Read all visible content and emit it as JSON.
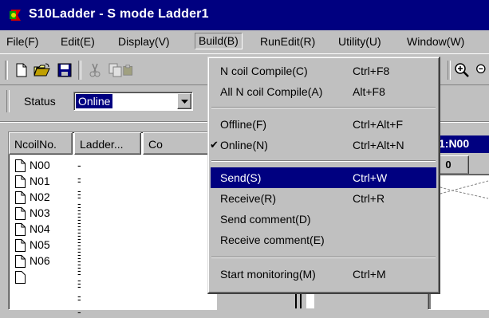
{
  "window": {
    "title": "S10Ladder - S mode Ladder1"
  },
  "menubar": {
    "items": [
      {
        "label": "File(F)"
      },
      {
        "label": "Edit(E)"
      },
      {
        "label": "Display(V)"
      },
      {
        "label": "Build(B)"
      },
      {
        "label": "RunEdit(R)"
      },
      {
        "label": "Utility(U)"
      },
      {
        "label": "Window(W)"
      }
    ]
  },
  "status": {
    "label": "Status",
    "value": "Online"
  },
  "list": {
    "columns": [
      "NcoilNo.",
      "Ladder...",
      "Co"
    ],
    "rows": [
      {
        "name": "N00",
        "value": "-----"
      },
      {
        "name": "N01",
        "value": "-----"
      },
      {
        "name": "N02",
        "value": "-----"
      },
      {
        "name": "N03",
        "value": "-----"
      },
      {
        "name": "N04",
        "value": "-----"
      },
      {
        "name": "N05",
        "value": "-----"
      },
      {
        "name": "N06",
        "value": "-----"
      }
    ]
  },
  "right_pane": {
    "title": "1:N00",
    "cell": "0"
  },
  "build_menu": {
    "items": [
      {
        "label": "N coil Compile(C)",
        "shortcut": "Ctrl+F8"
      },
      {
        "label": "All N coil Compile(A)",
        "shortcut": "Alt+F8"
      },
      {
        "label": "Offline(F)",
        "shortcut": "Ctrl+Alt+F"
      },
      {
        "label": "Online(N)",
        "shortcut": "Ctrl+Alt+N",
        "checked": true
      },
      {
        "label": "Send(S)",
        "shortcut": "Ctrl+W",
        "selected": true
      },
      {
        "label": "Receive(R)",
        "shortcut": "Ctrl+R"
      },
      {
        "label": "Send comment(D)",
        "shortcut": ""
      },
      {
        "label": "Receive comment(E)",
        "shortcut": ""
      },
      {
        "label": "Start monitoring(M)",
        "shortcut": "Ctrl+M"
      }
    ]
  },
  "colors": {
    "titlebar": "#000080",
    "selection": "#000080",
    "face": "#c0c0c0"
  }
}
